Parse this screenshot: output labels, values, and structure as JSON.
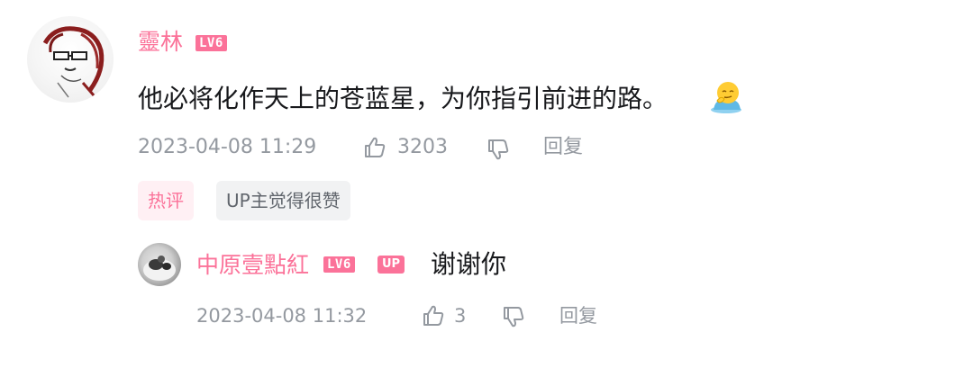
{
  "comment": {
    "username": "靈林",
    "level": "LV6",
    "content": "他必将化作天上的苍蓝星，为你指引前进的路。",
    "emoji": "thinking-face-emoji",
    "timestamp": "2023-04-08 11:29",
    "likes": "3203",
    "reply_label": "回复",
    "tags": [
      "热评",
      "UP主觉得很赞"
    ]
  },
  "reply": {
    "username": "中原壹點紅",
    "level": "LV6",
    "up_badge": "UP",
    "content": "谢谢你",
    "timestamp": "2023-04-08 11:32",
    "likes": "3",
    "reply_label": "回复"
  },
  "colors": {
    "accent_pink": "#fb7299",
    "meta_gray": "#9499a0",
    "text_dark": "#18191c"
  }
}
